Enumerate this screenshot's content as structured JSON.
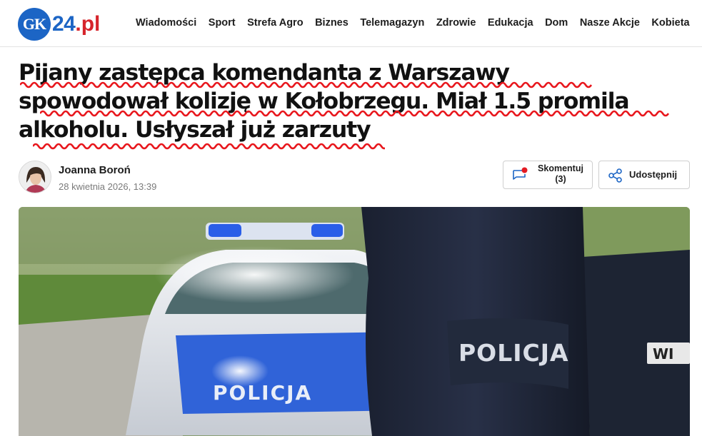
{
  "site": {
    "logo_gk": "GK",
    "logo_num": "24",
    "logo_domain": ".pl"
  },
  "nav": [
    "Wiadomości",
    "Sport",
    "Strefa Agro",
    "Biznes",
    "Telemagazyn",
    "Zdrowie",
    "Edukacja",
    "Dom",
    "Nasze Akcje",
    "Kobieta"
  ],
  "article": {
    "title_lines": [
      "Pijany zastępca komendanta z Warszawy",
      "spowodował kolizję w Kołobrzegu. Miał 1.5 promila",
      "alkoholu. Usłyszał już zarzuty"
    ],
    "author": "Joanna Boroń",
    "date": "28 kwietnia 2026, 13:39",
    "comment_label": "Skomentuj",
    "comment_count": "(3)",
    "share_label": "Udostępnij",
    "image_texts": {
      "sleeve": "POLICJA",
      "hood": "POLICJA",
      "plate": "WI"
    }
  },
  "colors": {
    "brand_blue": "#1c65c5",
    "brand_red": "#d6242b",
    "spellcheck_red": "#e8161c"
  },
  "icons": [
    "comment-icon",
    "notification-dot",
    "share-icon"
  ]
}
